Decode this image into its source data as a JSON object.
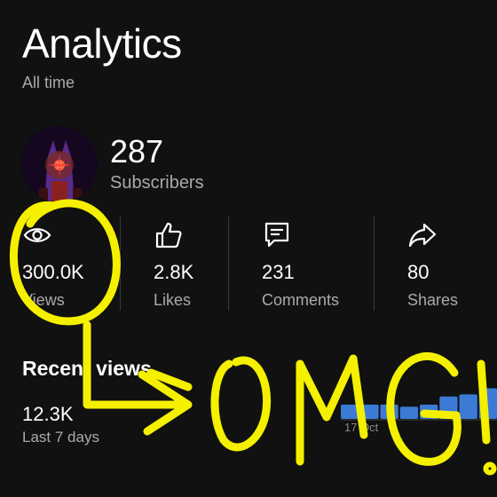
{
  "header": {
    "title": "Analytics",
    "subtitle": "All time"
  },
  "channel": {
    "subscriber_count": "287",
    "subscriber_label": "Subscribers"
  },
  "stats": [
    {
      "icon": "eye-icon",
      "value": "300.0K",
      "label": "Views"
    },
    {
      "icon": "thumbs-up-icon",
      "value": "2.8K",
      "label": "Likes"
    },
    {
      "icon": "comment-icon",
      "value": "231",
      "label": "Comments"
    },
    {
      "icon": "share-icon",
      "value": "80",
      "label": "Shares"
    }
  ],
  "recent": {
    "title": "Recent views",
    "value": "12.3K",
    "label": "Last 7 days"
  },
  "chart_data": {
    "type": "bar",
    "categories": [
      "",
      "",
      "",
      "",
      "",
      "",
      "",
      ""
    ],
    "values": [
      0.35,
      0.35,
      0.35,
      0.3,
      0.35,
      0.55,
      0.6,
      0.75
    ],
    "tick_labels": [
      "17 Oct"
    ],
    "color": "#3b7bd6"
  },
  "annotation": {
    "handwritten_text": "OMG!",
    "color": "#f5f000"
  },
  "colors": {
    "background": "#111111",
    "text_primary": "#ffffff",
    "text_secondary": "#aaaaaa",
    "divider": "#3a3a3a",
    "bar": "#3b7bd6",
    "marker": "#f5f000"
  }
}
